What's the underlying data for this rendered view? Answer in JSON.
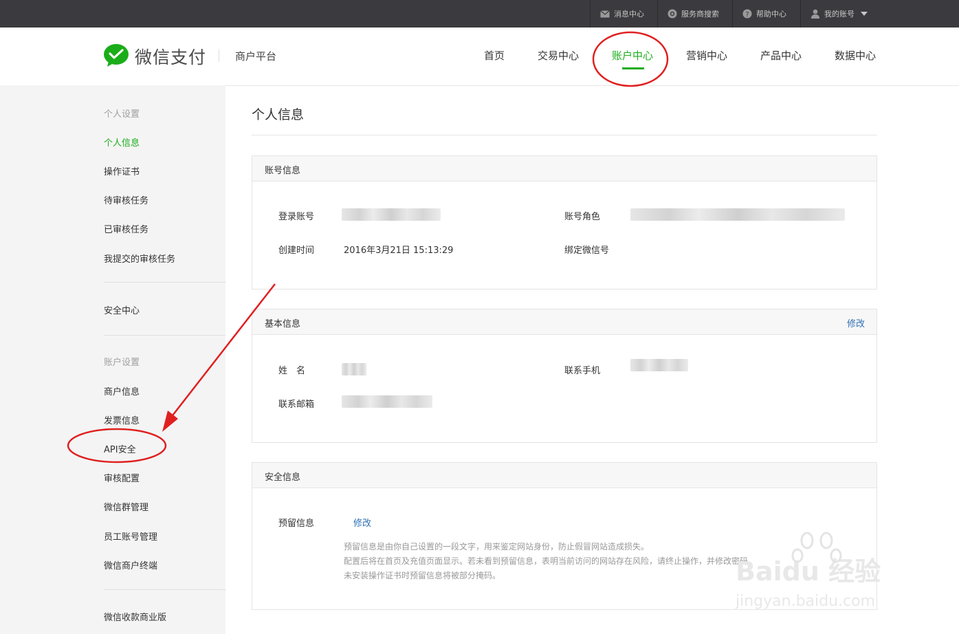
{
  "topbar": {
    "items": [
      {
        "label": "消息中心",
        "icon": "mail-icon"
      },
      {
        "label": "服务商搜索",
        "icon": "search-icon"
      },
      {
        "label": "帮助中心",
        "icon": "help-icon"
      },
      {
        "label": "我的账号",
        "icon": "user-icon"
      }
    ]
  },
  "header": {
    "logo_text": "微信支付",
    "platform": "商户平台",
    "nav": [
      "首页",
      "交易中心",
      "账户中心",
      "营销中心",
      "产品中心",
      "数据中心"
    ],
    "active_nav": "账户中心"
  },
  "sidebar": {
    "section1_title": "个人设置",
    "section1_items": [
      "个人信息",
      "操作证书",
      "待审核任务",
      "已审核任务",
      "我提交的审核任务"
    ],
    "security": "安全中心",
    "section2_title": "账户设置",
    "section2_items": [
      "商户信息",
      "发票信息",
      "API安全",
      "审核配置",
      "微信群管理",
      "员工账号管理",
      "微信商户终端"
    ],
    "bottom_item": "微信收款商业版",
    "active_item": "个人信息"
  },
  "main": {
    "page_title": "个人信息",
    "account_panel": {
      "title": "账号信息",
      "login_label": "登录账号",
      "role_label": "账号角色",
      "created_label": "创建时间",
      "created_value": "2016年3月21日 15:13:29",
      "wechat_label": "绑定微信号"
    },
    "basic_panel": {
      "title": "基本信息",
      "edit": "修改",
      "name_label": "姓　名",
      "phone_label": "联系手机",
      "email_label": "联系邮箱"
    },
    "security_panel": {
      "title": "安全信息",
      "reserved_label": "预留信息",
      "edit": "修改",
      "notes": [
        "预留信息是由你自己设置的一段文字，用来鉴定网站身份，防止假冒网站造成损失。",
        "配置后将在首页及充值页面显示。若未看到预留信息，表明当前访问的网站存在风险，请终止操作，并修改密码。",
        "未安装操作证书时预留信息将被部分掩码。"
      ]
    }
  },
  "watermark": {
    "brand": "Baidu 经验",
    "url": "jingyan.baidu.com"
  },
  "colors": {
    "accent": "#1aad19",
    "link": "#2f70b5",
    "annotation": "#e02020"
  }
}
